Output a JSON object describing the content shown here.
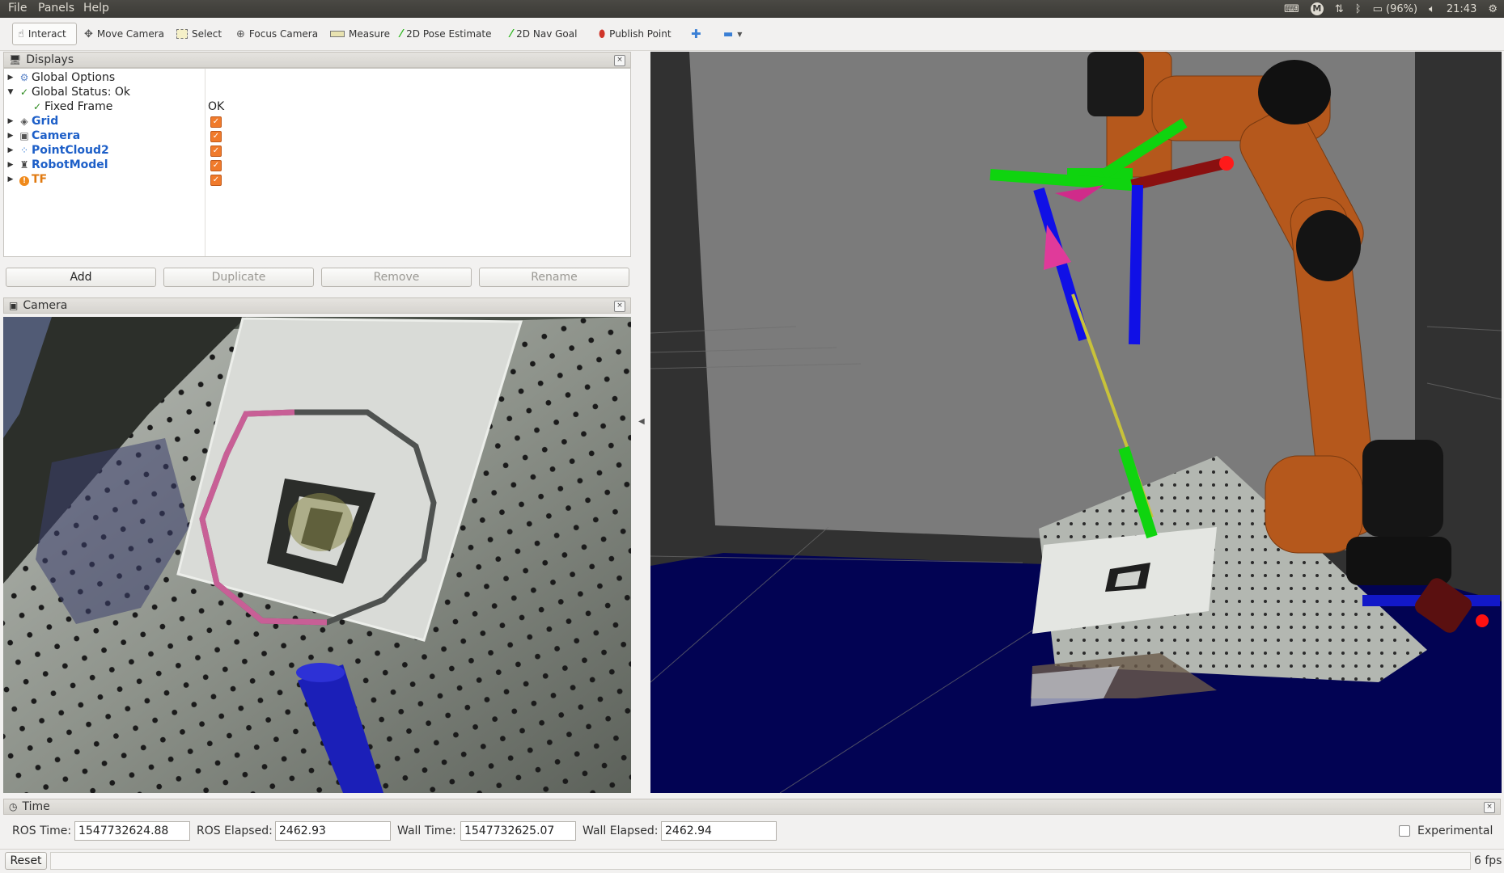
{
  "menubar": {
    "menus": [
      "File",
      "Panels",
      "Help"
    ],
    "battery": "(96%)",
    "clock": "21:43"
  },
  "toolbar": {
    "tools": [
      {
        "label": "Interact",
        "icon": "hand-cursor-icon"
      },
      {
        "label": "Move Camera",
        "icon": "move-camera-icon"
      },
      {
        "label": "Select",
        "icon": "select-box-icon"
      },
      {
        "label": "Focus Camera",
        "icon": "focus-camera-icon"
      },
      {
        "label": "Measure",
        "icon": "ruler-icon"
      },
      {
        "label": "2D Pose Estimate",
        "icon": "green-arrow-icon"
      },
      {
        "label": "2D Nav Goal",
        "icon": "green-arrow-icon"
      },
      {
        "label": "Publish Point",
        "icon": "map-pin-icon"
      }
    ]
  },
  "displays": {
    "title": "Displays",
    "items": [
      {
        "label": "Global Options"
      },
      {
        "label": "Global Status: Ok"
      },
      {
        "label": "Fixed Frame",
        "value": "OK"
      },
      {
        "label": "Grid"
      },
      {
        "label": "Camera"
      },
      {
        "label": "PointCloud2"
      },
      {
        "label": "RobotModel"
      },
      {
        "label": "TF"
      }
    ],
    "buttons": {
      "add": "Add",
      "duplicate": "Duplicate",
      "remove": "Remove",
      "rename": "Rename"
    }
  },
  "camera_panel": {
    "title": "Camera"
  },
  "time_panel": {
    "title": "Time",
    "ros_time_label": "ROS Time:",
    "ros_time": "1547732624.88",
    "ros_elapsed_label": "ROS Elapsed:",
    "ros_elapsed": "2462.93",
    "wall_time_label": "Wall Time:",
    "wall_time": "1547732625.07",
    "wall_elapsed_label": "Wall Elapsed:",
    "wall_elapsed": "2462.94",
    "experimental": "Experimental"
  },
  "status": {
    "reset": "Reset",
    "fps": "6 fps"
  },
  "colors": {
    "accent_blue": "#1d5fc8",
    "checkbox_orange": "#f07a2b",
    "robot_orange": "#b5581c"
  }
}
